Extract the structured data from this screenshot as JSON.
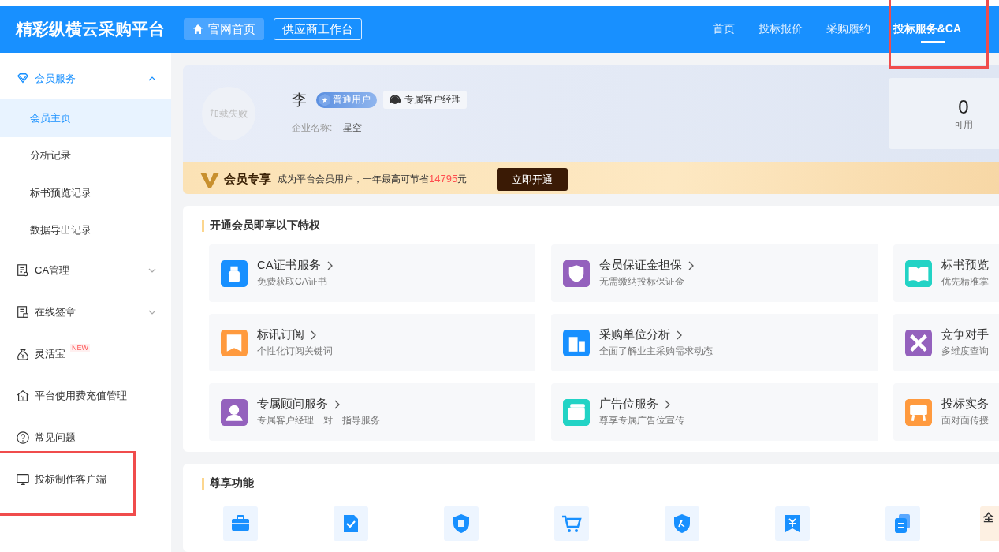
{
  "header": {
    "logo": "精彩纵横云采购平台",
    "buttons": [
      {
        "label": "官网首页",
        "kind": "filled"
      },
      {
        "label": "供应商工作台",
        "kind": "outline"
      }
    ],
    "nav": [
      {
        "label": "首页",
        "selected": false
      },
      {
        "label": "投标报价",
        "selected": false
      },
      {
        "label": "采购履约",
        "selected": false
      },
      {
        "label": "投标服务&CA",
        "selected": true
      }
    ]
  },
  "sidebar": {
    "items": [
      {
        "label": "会员服务",
        "expanded": true,
        "children": [
          {
            "label": "会员主页",
            "selected": true
          },
          {
            "label": "分析记录",
            "selected": false
          },
          {
            "label": "标书预览记录",
            "selected": false
          },
          {
            "label": "数据导出记录",
            "selected": false
          }
        ]
      },
      {
        "label": "CA管理",
        "expanded": false
      },
      {
        "label": "在线签章",
        "expanded": false
      },
      {
        "label": "灵活宝",
        "badge": "NEW"
      },
      {
        "label": "平台使用费充值管理"
      },
      {
        "label": "常见问题"
      },
      {
        "label": "投标制作客户端"
      }
    ]
  },
  "profile": {
    "avatar_text": "加载失败",
    "name": "李",
    "level": "普通用户",
    "manager": "专属客户经理",
    "company_label": "企业名称:",
    "company": "星空",
    "stat_value": "0",
    "stat_label": "可用"
  },
  "banner": {
    "title": "会员专享",
    "text_before": "成为平台会员用户，一年最高可节省",
    "amount": "14795",
    "text_after": "元",
    "button": "立即开通"
  },
  "privileges": {
    "title": "开通会员即享以下特权",
    "cards": [
      {
        "title": "CA证书服务",
        "subtitle": "免费获取CA证书",
        "color": "#1890ff",
        "chevron": true
      },
      {
        "title": "会员保证金担保",
        "subtitle": "无需缴纳投标保证金",
        "color": "#9461bd",
        "chevron": true
      },
      {
        "title": "标书预览",
        "subtitle": "优先精准掌",
        "color": "#22d3c5",
        "chevron": false
      },
      {
        "title": "标讯订阅",
        "subtitle": "个性化订阅关键词",
        "color": "#ff9a3e",
        "chevron": true
      },
      {
        "title": "采购单位分析",
        "subtitle": "全面了解业主采购需求动态",
        "color": "#1890ff",
        "chevron": true
      },
      {
        "title": "竞争对手",
        "subtitle": "多维度查询",
        "color": "#9461bd",
        "chevron": false
      },
      {
        "title": "专属顾问服务",
        "subtitle": "专属客户经理一对一指导服务",
        "color": "#9461bd",
        "chevron": true
      },
      {
        "title": "广告位服务",
        "subtitle": "尊享专属广告位宣传",
        "color": "#22d3c5",
        "chevron": true
      },
      {
        "title": "投标实务",
        "subtitle": "面对面传授",
        "color": "#ff9a3e",
        "chevron": false
      }
    ]
  },
  "features": {
    "title": "尊享功能",
    "items": [
      {
        "kind": "icon"
      },
      {
        "kind": "icon"
      },
      {
        "kind": "icon"
      },
      {
        "kind": "icon"
      },
      {
        "kind": "icon"
      },
      {
        "kind": "icon"
      },
      {
        "kind": "icon"
      },
      {
        "kind": "promo",
        "text": "全"
      }
    ]
  }
}
